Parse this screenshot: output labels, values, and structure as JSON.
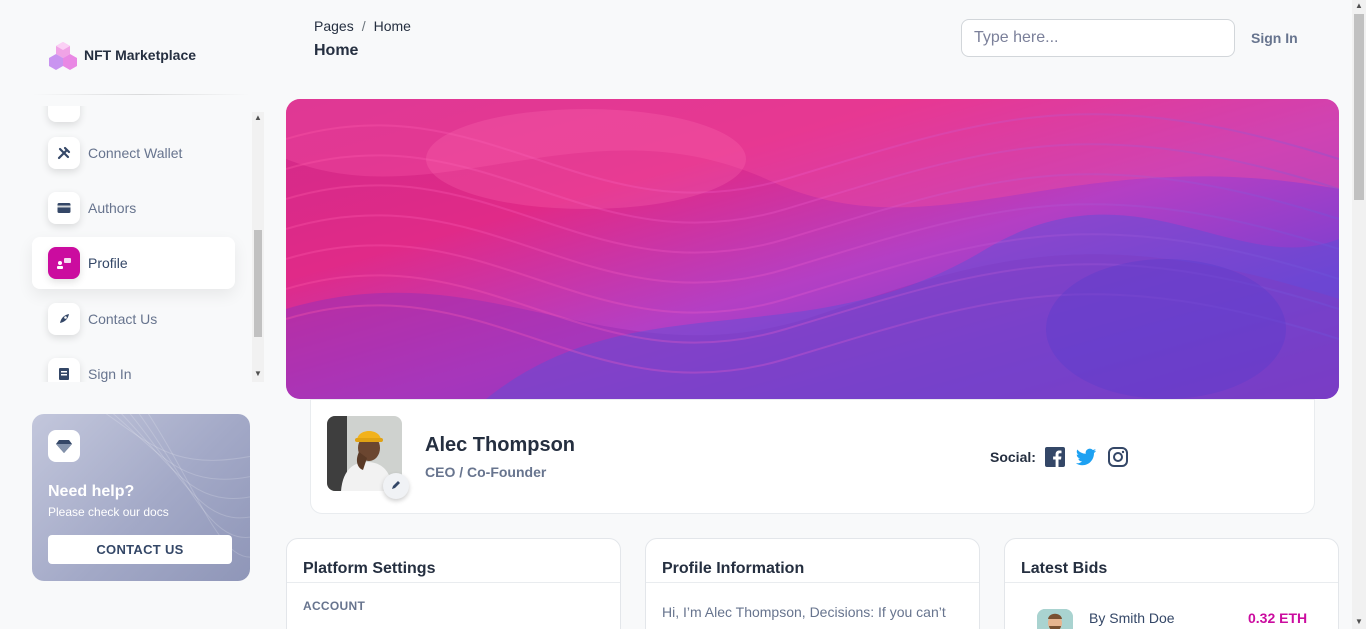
{
  "brand": {
    "name": "NFT Marketplace"
  },
  "nav": {
    "items": [
      {
        "label": "Connect Wallet",
        "icon": "tools-icon"
      },
      {
        "label": "Authors",
        "icon": "credit-card-icon"
      },
      {
        "label": "Profile",
        "icon": "user-group-icon",
        "active": true
      },
      {
        "label": "Contact Us",
        "icon": "rocket-icon"
      },
      {
        "label": "Sign In",
        "icon": "document-icon"
      }
    ]
  },
  "help": {
    "title": "Need help?",
    "subtitle": "Please check our docs",
    "button": "CONTACT US"
  },
  "header": {
    "breadcrumb": [
      "Pages",
      "Home"
    ],
    "separator": "/",
    "title": "Home",
    "search_placeholder": "Type here...",
    "signin_label": "Sign In"
  },
  "profile": {
    "name": "Alec Thompson",
    "role": "CEO / Co-Founder",
    "social_label": "Social:"
  },
  "cards": {
    "settings": {
      "title": "Platform Settings",
      "section": "ACCOUNT"
    },
    "info": {
      "title": "Profile Information",
      "text": "Hi, I’m Alec Thompson, Decisions: If you can’t decide, the answer is no. If two equally"
    },
    "bids": {
      "title": "Latest Bids",
      "by_prefix": "By",
      "name": "Smith Doe",
      "amount": "0.32 ETH"
    }
  },
  "colors": {
    "accent": "#cb0c9f",
    "text": "#344767",
    "muted": "#67748e",
    "social": "#344767"
  }
}
